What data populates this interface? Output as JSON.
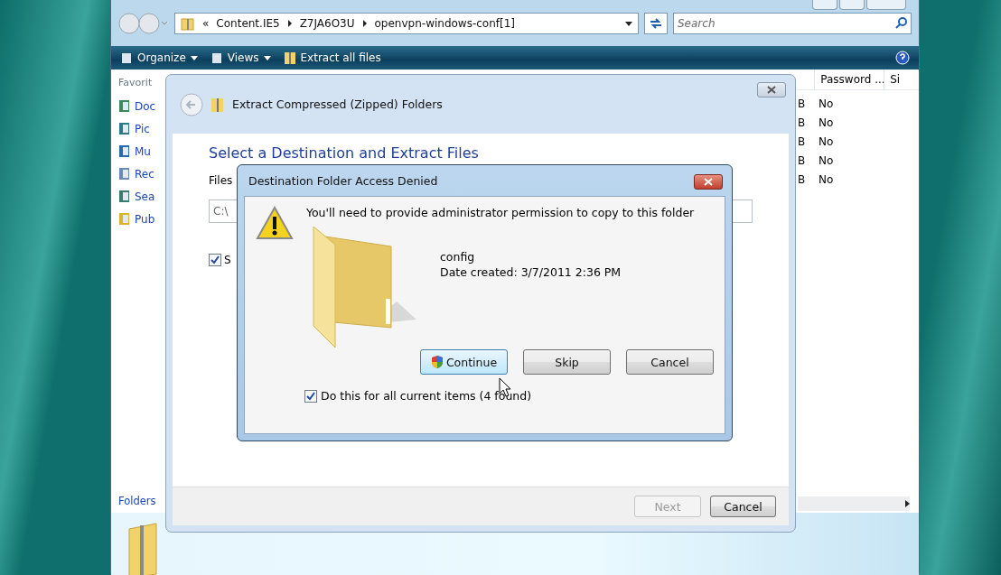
{
  "explorer": {
    "address": {
      "crumbs": [
        "«",
        "Content.IE5",
        "Z7JA6O3U",
        "openvpn-windows-conf[1]"
      ]
    },
    "search": {
      "placeholder": "Search"
    },
    "toolbar": [
      {
        "label": "Organize",
        "kind": "menu"
      },
      {
        "label": "Views",
        "kind": "menu"
      },
      {
        "label": "Extract all files",
        "kind": "button"
      }
    ],
    "favorites_heading": "Favorit",
    "favorites": [
      {
        "label": "Doc",
        "kind": "documents"
      },
      {
        "label": "Pic",
        "kind": "pictures"
      },
      {
        "label": "Mu",
        "kind": "music"
      },
      {
        "label": "Rec",
        "kind": "recent"
      },
      {
        "label": "Sea",
        "kind": "searches"
      },
      {
        "label": "Pub",
        "kind": "public"
      }
    ],
    "columns": [
      "Password ...",
      "Si"
    ],
    "rows": [
      {
        "column_1": "B",
        "password": "No"
      },
      {
        "column_1": "B",
        "password": "No"
      },
      {
        "column_1": "B",
        "password": "No"
      },
      {
        "column_1": "B",
        "password": "No"
      },
      {
        "column_1": "B",
        "password": "No"
      }
    ],
    "folders_label": "Folders"
  },
  "wizard": {
    "title": "Extract Compressed (Zipped) Folders",
    "heading": "Select a Destination and Extract Files",
    "files_label": "Files",
    "path_value": "C:\\",
    "show_checkbox": {
      "label": "S",
      "checked": true
    },
    "buttons": [
      {
        "label": "Next",
        "disabled": true
      },
      {
        "label": "Cancel",
        "disabled": false
      }
    ]
  },
  "dialog": {
    "title": "Destination Folder Access Denied",
    "message": "You'll need to provide administrator permission to copy to this folder",
    "folder_name": "config",
    "date_created": "Date created: 3/7/2011 2:36 PM",
    "buttons": [
      {
        "label": "Continue",
        "focused": true,
        "shield": true
      },
      {
        "label": "Skip",
        "focused": false,
        "shield": false
      },
      {
        "label": "Cancel",
        "focused": false,
        "shield": false
      }
    ],
    "apply_all": {
      "label": "Do this for all current items (4 found)",
      "checked": true
    }
  }
}
